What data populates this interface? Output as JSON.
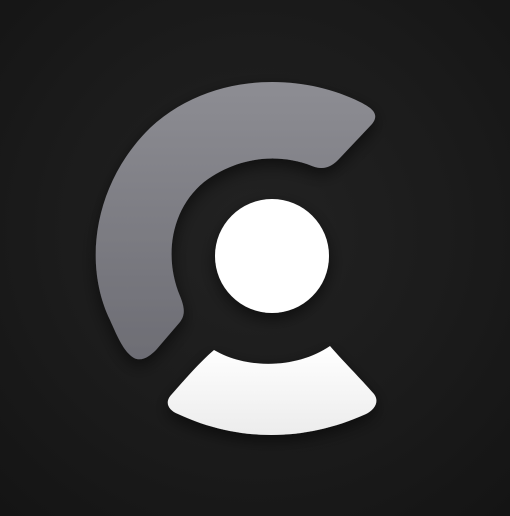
{
  "app_icon": {
    "name": "logo-mark",
    "colors": {
      "background": "#1a1a1a",
      "arc": "#8a8a90",
      "arc_shade": "#6f6f76",
      "head": "#ffffff",
      "body": "#f2f2f2"
    }
  }
}
